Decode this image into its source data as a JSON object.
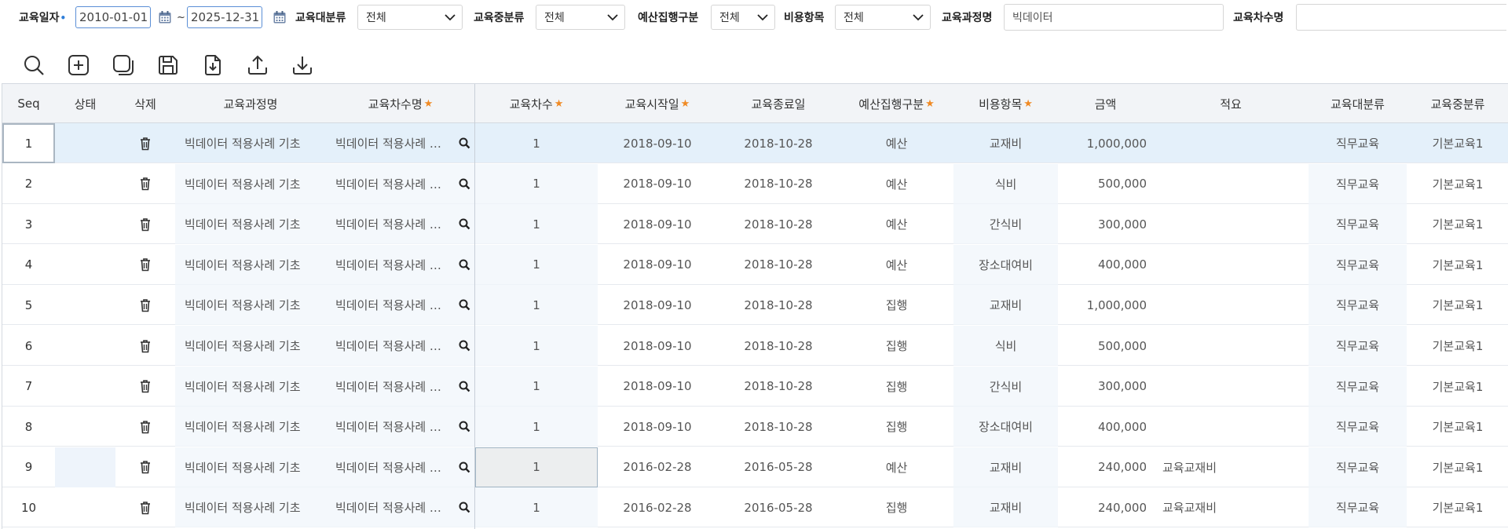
{
  "filters": {
    "edu_date_label": "교육일자",
    "date_from": "2010-01-01",
    "date_sep": "~",
    "date_to": "2025-12-31",
    "major_cat_label": "교육대분류",
    "major_cat_value": "전체",
    "mid_cat_label": "교육중분류",
    "mid_cat_value": "전체",
    "budget_type_label": "예산집행구분",
    "budget_type_value": "전체",
    "cost_item_label": "비용항목",
    "cost_item_value": "전체",
    "course_name_label": "교육과정명",
    "course_name_value": "빅데이터",
    "session_name_label": "교육차수명",
    "session_name_value": ""
  },
  "toolbar": [
    {
      "name": "search-button",
      "icon": "search-icon"
    },
    {
      "name": "add-button",
      "icon": "plus-square-icon"
    },
    {
      "name": "copy-button",
      "icon": "copy-icon"
    },
    {
      "name": "save-button",
      "icon": "floppy-disk-icon"
    },
    {
      "name": "import-button",
      "icon": "file-download-icon"
    },
    {
      "name": "upload-button",
      "icon": "upload-icon"
    },
    {
      "name": "download-button",
      "icon": "download-icon"
    }
  ],
  "colors": {
    "accent_blue": "#2f7ed8",
    "required_star": "#f08a24",
    "header_bg": "#f2f4f7",
    "selected_row": "#e4f0fa"
  },
  "grid": {
    "columns": [
      {
        "key": "seq",
        "label": "Seq",
        "required": false
      },
      {
        "key": "status",
        "label": "상태",
        "required": false
      },
      {
        "key": "delete",
        "label": "삭제",
        "required": false
      },
      {
        "key": "course",
        "label": "교육과정명",
        "required": false
      },
      {
        "key": "session_name",
        "label": "교육차수명",
        "required": true
      },
      {
        "key": "session_no",
        "label": "교육차수",
        "required": true
      },
      {
        "key": "start",
        "label": "교육시작일",
        "required": true
      },
      {
        "key": "end",
        "label": "교육종료일",
        "required": false
      },
      {
        "key": "budget",
        "label": "예산집행구분",
        "required": true
      },
      {
        "key": "cost_item",
        "label": "비용항목",
        "required": true
      },
      {
        "key": "amount",
        "label": "금액",
        "required": false
      },
      {
        "key": "memo",
        "label": "적요",
        "required": false
      },
      {
        "key": "major",
        "label": "교육대분류",
        "required": false
      },
      {
        "key": "mid",
        "label": "교육중분류",
        "required": false
      }
    ],
    "rows": [
      {
        "seq": "1",
        "status": "",
        "course": "빅데이터 적용사례 기초",
        "session_name": "빅데이터 적용사례 …",
        "session_no": "1",
        "start": "2018-09-10",
        "end": "2018-10-28",
        "budget": "예산",
        "cost_item": "교재비",
        "amount": "1,000,000",
        "memo": "",
        "major": "직무교육",
        "mid": "기본교육1"
      },
      {
        "seq": "2",
        "status": "",
        "course": "빅데이터 적용사례 기초",
        "session_name": "빅데이터 적용사례 …",
        "session_no": "1",
        "start": "2018-09-10",
        "end": "2018-10-28",
        "budget": "예산",
        "cost_item": "식비",
        "amount": "500,000",
        "memo": "",
        "major": "직무교육",
        "mid": "기본교육1"
      },
      {
        "seq": "3",
        "status": "",
        "course": "빅데이터 적용사례 기초",
        "session_name": "빅데이터 적용사례 …",
        "session_no": "1",
        "start": "2018-09-10",
        "end": "2018-10-28",
        "budget": "예산",
        "cost_item": "간식비",
        "amount": "300,000",
        "memo": "",
        "major": "직무교육",
        "mid": "기본교육1"
      },
      {
        "seq": "4",
        "status": "",
        "course": "빅데이터 적용사례 기초",
        "session_name": "빅데이터 적용사례 …",
        "session_no": "1",
        "start": "2018-09-10",
        "end": "2018-10-28",
        "budget": "예산",
        "cost_item": "장소대여비",
        "amount": "400,000",
        "memo": "",
        "major": "직무교육",
        "mid": "기본교육1"
      },
      {
        "seq": "5",
        "status": "",
        "course": "빅데이터 적용사례 기초",
        "session_name": "빅데이터 적용사례 …",
        "session_no": "1",
        "start": "2018-09-10",
        "end": "2018-10-28",
        "budget": "집행",
        "cost_item": "교재비",
        "amount": "1,000,000",
        "memo": "",
        "major": "직무교육",
        "mid": "기본교육1"
      },
      {
        "seq": "6",
        "status": "",
        "course": "빅데이터 적용사례 기초",
        "session_name": "빅데이터 적용사례 …",
        "session_no": "1",
        "start": "2018-09-10",
        "end": "2018-10-28",
        "budget": "집행",
        "cost_item": "식비",
        "amount": "500,000",
        "memo": "",
        "major": "직무교육",
        "mid": "기본교육1"
      },
      {
        "seq": "7",
        "status": "",
        "course": "빅데이터 적용사례 기초",
        "session_name": "빅데이터 적용사례 …",
        "session_no": "1",
        "start": "2018-09-10",
        "end": "2018-10-28",
        "budget": "집행",
        "cost_item": "간식비",
        "amount": "300,000",
        "memo": "",
        "major": "직무교육",
        "mid": "기본교육1"
      },
      {
        "seq": "8",
        "status": "",
        "course": "빅데이터 적용사례 기초",
        "session_name": "빅데이터 적용사례 …",
        "session_no": "1",
        "start": "2018-09-10",
        "end": "2018-10-28",
        "budget": "집행",
        "cost_item": "장소대여비",
        "amount": "400,000",
        "memo": "",
        "major": "직무교육",
        "mid": "기본교육1"
      },
      {
        "seq": "9",
        "status": "",
        "course": "빅데이터 적용사례 기초",
        "session_name": "빅데이터 적용사례 …",
        "session_no": "1",
        "start": "2016-02-28",
        "end": "2016-05-28",
        "budget": "예산",
        "cost_item": "교재비",
        "amount": "240,000",
        "memo": "교육교재비",
        "major": "직무교육",
        "mid": "기본교육1"
      },
      {
        "seq": "10",
        "status": "",
        "course": "빅데이터 적용사례 기초",
        "session_name": "빅데이터 적용사례 …",
        "session_no": "1",
        "start": "2016-02-28",
        "end": "2016-05-28",
        "budget": "집행",
        "cost_item": "교재비",
        "amount": "240,000",
        "memo": "교육교재비",
        "major": "직무교육",
        "mid": "기본교육1"
      }
    ]
  }
}
